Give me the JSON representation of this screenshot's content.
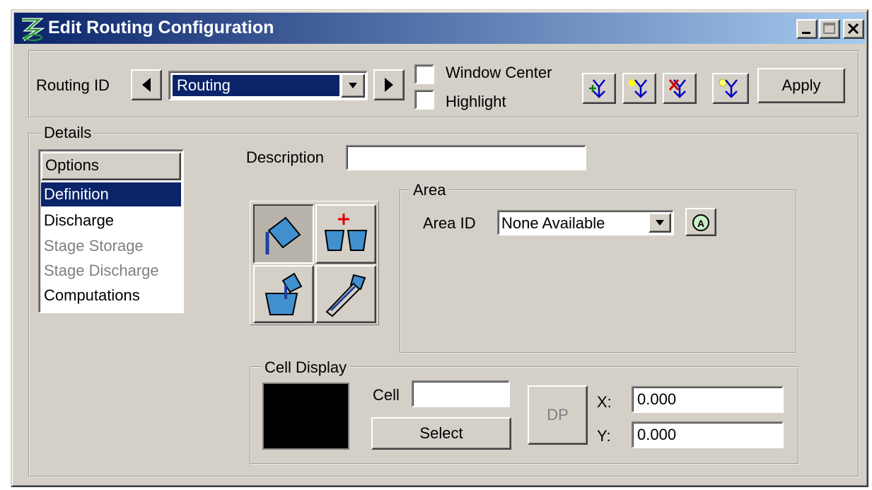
{
  "window": {
    "title": "Edit Routing Configuration"
  },
  "toolbar": {
    "routing_id_label": "Routing ID",
    "routing_value": "Routing",
    "window_center_label": "Window Center",
    "highlight_label": "Highlight",
    "apply_label": "Apply"
  },
  "details": {
    "legend": "Details",
    "list_header": "Options",
    "items": [
      "Definition",
      "Discharge",
      "Stage Storage",
      "Stage Discharge",
      "Computations"
    ],
    "description_label": "Description",
    "description_value": ""
  },
  "area": {
    "legend": "Area",
    "area_id_label": "Area ID",
    "area_id_value": "None Available"
  },
  "cell_display": {
    "legend": "Cell Display",
    "cell_label": "Cell",
    "cell_value": "",
    "select_label": "Select",
    "dp_label": "DP",
    "x_label": "X:",
    "y_label": "Y:",
    "x_value": "0.000",
    "y_value": "0.000"
  },
  "colors": {
    "title_bar": "#0a246a",
    "face": "#d4d0c8",
    "selection": "#0a246a"
  }
}
